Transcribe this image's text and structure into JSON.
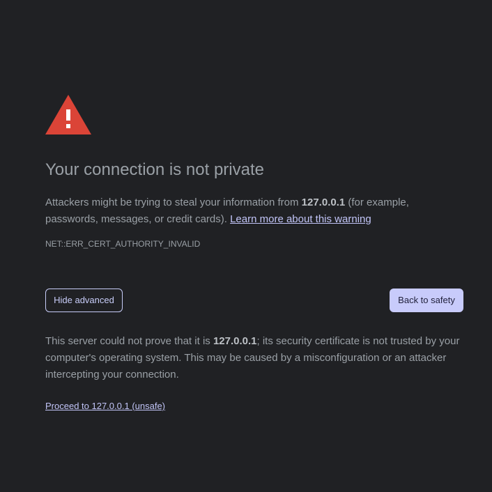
{
  "interstitial": {
    "icon": "warning-triangle-icon",
    "accent_color": "#db4437",
    "title": "Your connection is not private",
    "main_message": {
      "prefix": "Attackers might be trying to steal your information from ",
      "host": "127.0.0.1",
      "suffix": " (for example, passwords, messages, or credit cards). ",
      "learn_more_link": "Learn more about this warning"
    },
    "error_code": "NET::ERR_CERT_AUTHORITY_INVALID",
    "hide_advanced_label": "Hide advanced",
    "back_to_safety_label": "Back to safety",
    "details": {
      "prefix": "This server could not prove that it is ",
      "host": "127.0.0.1",
      "suffix": "; its security certificate is not trusted by your computer's operating system. This may be caused by a misconfiguration or an attacker intercepting your connection."
    },
    "proceed_link": "Proceed to 127.0.0.1 (unsafe)"
  }
}
